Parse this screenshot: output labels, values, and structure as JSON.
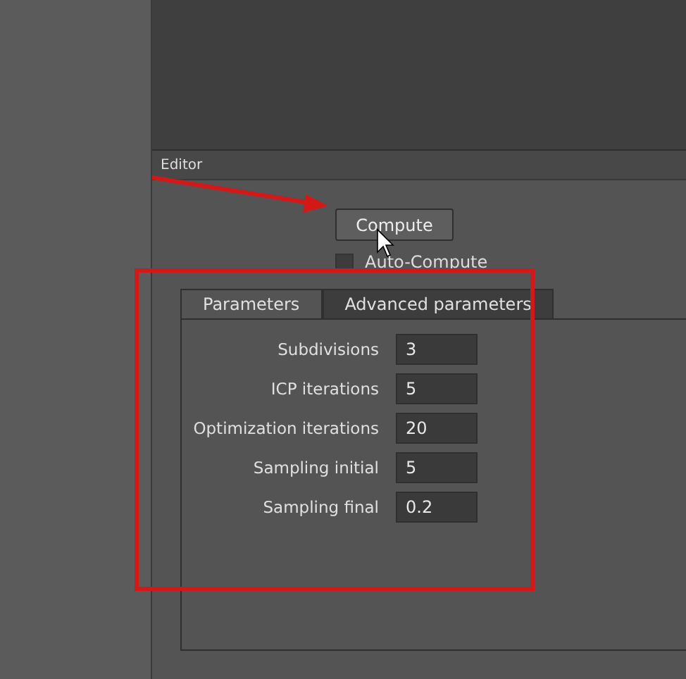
{
  "panel": {
    "title": "Editor"
  },
  "compute_button": {
    "label": "Compute"
  },
  "auto_compute": {
    "label": "Auto-Compute",
    "checked": false
  },
  "tabs": [
    {
      "label": "Parameters",
      "selected": true
    },
    {
      "label": "Advanced parameters",
      "selected": false
    }
  ],
  "parameters": [
    {
      "label": "Subdivisions",
      "value": "3"
    },
    {
      "label": "ICP iterations",
      "value": "5"
    },
    {
      "label": "Optimization iterations",
      "value": "20"
    },
    {
      "label": "Sampling initial",
      "value": "5"
    },
    {
      "label": "Sampling final",
      "value": "0.2"
    }
  ]
}
